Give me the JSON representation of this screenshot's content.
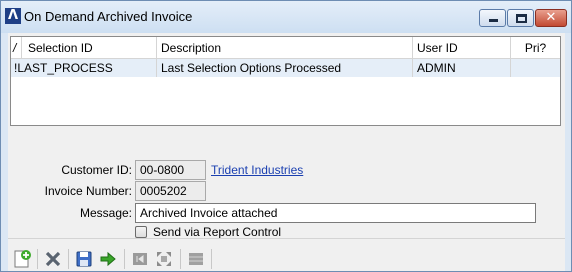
{
  "window": {
    "title": "On Demand Archived Invoice",
    "logo_glyph": "Λ"
  },
  "grid": {
    "sort_indicator": "/",
    "columns": [
      "Selection ID",
      "Description",
      "User ID",
      "Pri?"
    ],
    "rows": [
      {
        "selection_id": "!LAST_PROCESS",
        "description": "Last Selection Options Processed",
        "user_id": "ADMIN",
        "pri": ""
      }
    ]
  },
  "form": {
    "customer_id_label": "Customer ID:",
    "customer_id": "00-0800",
    "customer_name": "Trident Industries",
    "invoice_number_label": "Invoice Number:",
    "invoice_number": "0005202",
    "message_label": "Message:",
    "message": "Archived Invoice attached",
    "send_via_report_control_label": "Send via Report Control",
    "send_via_report_control": false
  },
  "toolbar": {
    "icons": [
      "new-icon",
      "delete-icon",
      "save-icon",
      "proceed-arrow-icon",
      "first-record-icon",
      "expand-icon",
      "list-icon"
    ]
  },
  "colors": {
    "titlebar": "#d6e4f3",
    "selected_row": "#e5eef8",
    "link": "#1a3fb0",
    "close_button": "#c24a33"
  }
}
